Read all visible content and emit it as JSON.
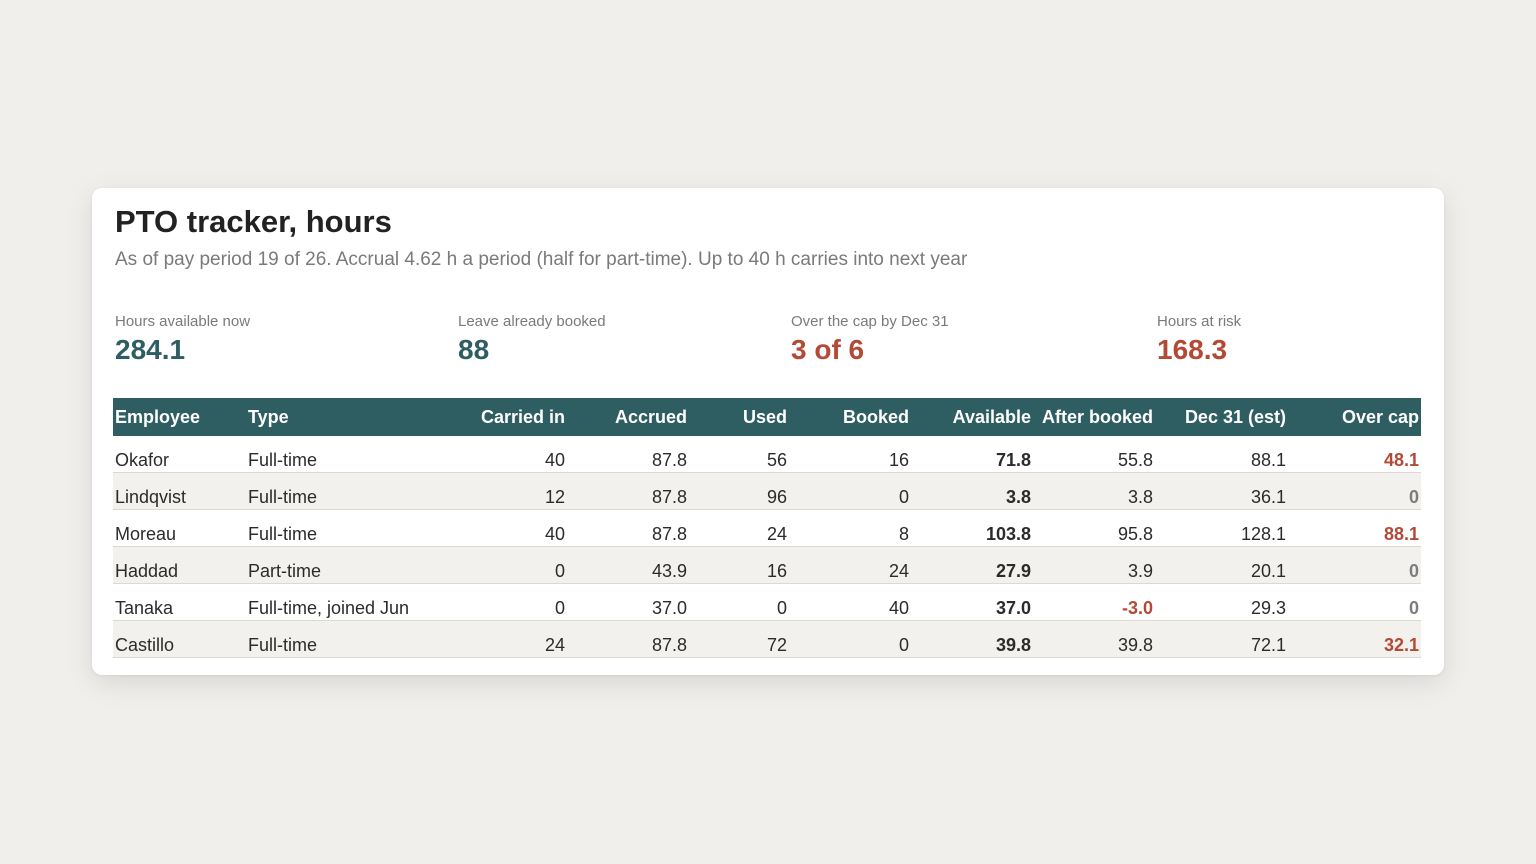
{
  "title": "PTO tracker, hours",
  "subtitle": "As of pay period 19 of 26. Accrual 4.62 h a period (half for part-time). Up to 40 h carries into next year",
  "kpis": [
    {
      "label": "Hours available now",
      "value": "284.1",
      "tone": "teal"
    },
    {
      "label": "Leave already booked",
      "value": "88",
      "tone": "teal"
    },
    {
      "label": "Over the cap by Dec 31",
      "value": "3 of 6",
      "tone": "red"
    },
    {
      "label": "Hours at risk",
      "value": "168.3",
      "tone": "red"
    }
  ],
  "colors": {
    "header_bg": "#2e5d62",
    "accent_teal": "#2e5d62",
    "accent_red": "#b34a36",
    "page_bg": "#f0efec"
  },
  "table": {
    "headers": [
      "Employee",
      "Type",
      "Carried in",
      "Accrued",
      "Used",
      "Booked",
      "Available",
      "After booked",
      "Dec 31 (est)",
      "Over cap"
    ],
    "rows": [
      {
        "employee": "Okafor",
        "type": "Full-time",
        "carried_in": "40",
        "accrued": "87.8",
        "used": "56",
        "booked": "16",
        "available": "71.8",
        "after_booked": "55.8",
        "dec31": "88.1",
        "over_cap": "48.1"
      },
      {
        "employee": "Lindqvist",
        "type": "Full-time",
        "carried_in": "12",
        "accrued": "87.8",
        "used": "96",
        "booked": "0",
        "available": "3.8",
        "after_booked": "3.8",
        "dec31": "36.1",
        "over_cap": "0"
      },
      {
        "employee": "Moreau",
        "type": "Full-time",
        "carried_in": "40",
        "accrued": "87.8",
        "used": "24",
        "booked": "8",
        "available": "103.8",
        "after_booked": "95.8",
        "dec31": "128.1",
        "over_cap": "88.1"
      },
      {
        "employee": "Haddad",
        "type": "Part-time",
        "carried_in": "0",
        "accrued": "43.9",
        "used": "16",
        "booked": "24",
        "available": "27.9",
        "after_booked": "3.9",
        "dec31": "20.1",
        "over_cap": "0"
      },
      {
        "employee": "Tanaka",
        "type": "Full-time, joined Jun",
        "carried_in": "0",
        "accrued": "37.0",
        "used": "0",
        "booked": "40",
        "available": "37.0",
        "after_booked": "-3.0",
        "dec31": "29.3",
        "over_cap": "0"
      },
      {
        "employee": "Castillo",
        "type": "Full-time",
        "carried_in": "24",
        "accrued": "87.8",
        "used": "72",
        "booked": "0",
        "available": "39.8",
        "after_booked": "39.8",
        "dec31": "72.1",
        "over_cap": "32.1"
      }
    ]
  }
}
